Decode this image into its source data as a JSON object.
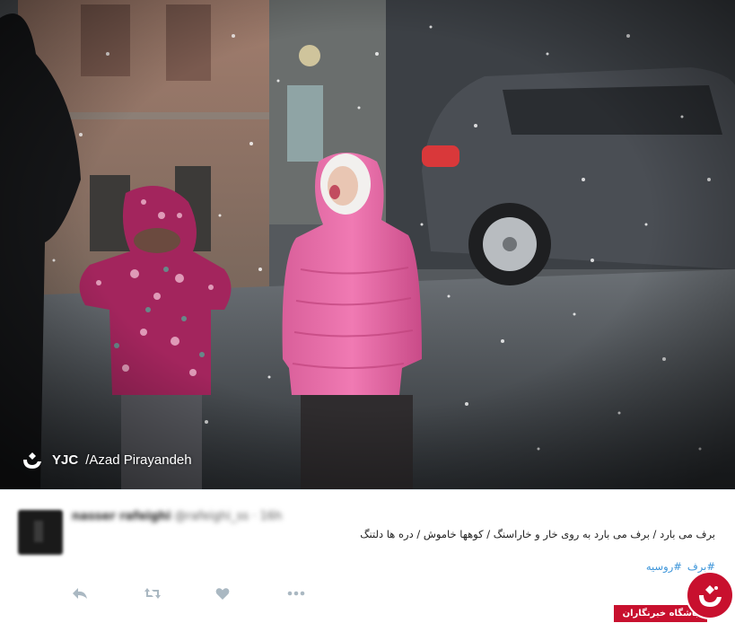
{
  "photo": {
    "watermark_brand": "YJC",
    "watermark_credit": "/Azad Pirayandeh",
    "logo_icon": "yjc-logo-icon"
  },
  "tweet": {
    "username": "nasser rafeighi",
    "handle": "@rafeighi_ss · 16h",
    "text": "برف می بارد / برف می بارد به روی خار و خاراسنگ / کوهها خاموش / دره ها دلتنگ",
    "hashtags": [
      "#برف",
      "#روسیه"
    ],
    "actions": [
      "reply-icon",
      "retweet-icon",
      "like-icon",
      "more-icon"
    ],
    "link_color": "#3b94d9"
  },
  "badge": {
    "label": "باشگاه خبرنگاران",
    "color": "#c8102e"
  }
}
